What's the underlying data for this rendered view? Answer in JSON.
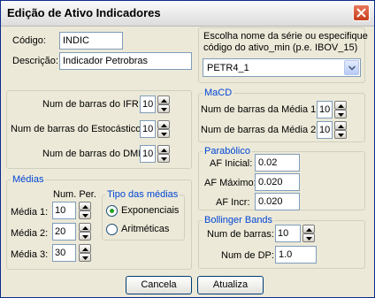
{
  "window": {
    "title": "Edição de Ativo Indicadores"
  },
  "ativo": {
    "codigo_label": "Código:",
    "codigo_value": "INDIC",
    "descricao_label": "Descrição:",
    "descricao_value": "Indicador Petrobras"
  },
  "serie": {
    "prompt_line1": "Escolha nome da série ou especifique",
    "prompt_line2": "código do ativo_min (p.e. IBOV_15)",
    "selected": "PETR4_1"
  },
  "barras": {
    "ifr_label": "Num de barras do IFR:",
    "ifr_value": "10",
    "estocastico_label": "Num de barras do Estocástico:",
    "estocastico_value": "10",
    "dmi_label": "Num de barras do DMI:",
    "dmi_value": "10"
  },
  "macd": {
    "group_label": "MaCD",
    "media1_label": "Num de barras da Média 1:",
    "media1_value": "10",
    "media2_label": "Num de barras da Média 2:",
    "media2_value": "10"
  },
  "parabolico": {
    "group_label": "Parabólico",
    "af_inicial_label": "AF Inicial:",
    "af_inicial_value": "0.02",
    "af_maximo_label": "AF Máximo:",
    "af_maximo_value": "0.020",
    "af_incr_label": "AF Incr:",
    "af_incr_value": "0.020"
  },
  "medias": {
    "group_label": "Médias",
    "num_per_label": "Num. Per.",
    "media1_label": "Média 1:",
    "media1_value": "10",
    "media2_label": "Média 2:",
    "media2_value": "20",
    "media3_label": "Média 3:",
    "media3_value": "30",
    "tipo_label": "Tipo das médias",
    "option_exponenciais": "Exponenciais",
    "option_aritmeticas": "Aritméticas",
    "selected_option": "Exponenciais"
  },
  "bollinger": {
    "group_label": "Bollinger Bands",
    "barras_label": "Num de barras:",
    "barras_value": "10",
    "dp_label": "Num de DP:",
    "dp_value": "1.0"
  },
  "buttons": {
    "cancel": "Cancela",
    "update": "Atualiza"
  },
  "colors": {
    "group_label": "#0046d5",
    "dialog_bg": "#ece9d8",
    "close_button": "#c73e1b",
    "radio_selected": "#21a121"
  }
}
